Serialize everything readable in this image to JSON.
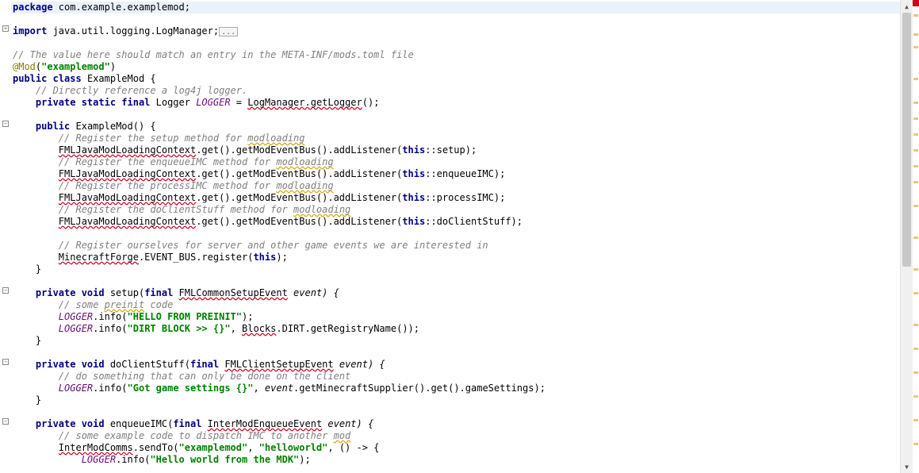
{
  "code": {
    "l1_kw1": "package",
    "l1_pkg": " com.example.examplemod;",
    "l3_kw": "import",
    "l3_txt": " java.util.logging.LogManager;",
    "l5": "// The value here should match an entry in the META-INF/mods.toml file",
    "l6_ann": "@Mod",
    "l6_p": "(",
    "l6_str": "\"examplemod\"",
    "l6_p2": ")",
    "l7_kw1": "public",
    "l7_kw2": "class",
    "l7_name": " ExampleMod {",
    "l8": "    // Directly reference a log4j logger.",
    "l9_kw": "private static final",
    "l9_type": " Logger ",
    "l9_fld": "LOGGER",
    "l9_eq": " = ",
    "l9_err": "LogManager.getLogger",
    "l9_end": "();",
    "l11_kw": "public",
    "l11_txt": " ExampleMod() {",
    "l12": "        // Register the setup method for ",
    "l12_warn": "modloading",
    "l13_a": "        ",
    "l13_err": "FMLJavaModLoadingContext",
    "l13_b": ".get().getModEventBus().addListener(",
    "l13_kw": "this",
    "l13_c": "::setup);",
    "l14": "        // Register the enqueueIMC method for ",
    "l14_warn": "modloading",
    "l15_a": "        ",
    "l15_err": "FMLJavaModLoadingContext",
    "l15_b": ".get().getModEventBus().addListener(",
    "l15_kw": "this",
    "l15_c": "::enqueueIMC);",
    "l16": "        // Register the processIMC method for ",
    "l16_warn": "modloading",
    "l17_a": "        ",
    "l17_err": "FMLJavaModLoadingContext",
    "l17_b": ".get().getModEventBus().addListener(",
    "l17_kw": "this",
    "l17_c": "::processIMC);",
    "l18": "        // Register the doClientStuff method for ",
    "l18_warn": "modloading",
    "l19_a": "        ",
    "l19_err": "FMLJavaModLoadingContext",
    "l19_b": ".get().getModEventBus().addListener(",
    "l19_kw": "this",
    "l19_c": "::doClientStuff);",
    "l21": "        // Register ourselves for server and other game events we are interested in",
    "l22_a": "        ",
    "l22_err": "MinecraftForge",
    "l22_b": ".EVENT_BUS.register(",
    "l22_kw": "this",
    "l22_c": ");",
    "l23": "    }",
    "l25_kw": "private void",
    "l25_name": " setup(",
    "l25_kw2": "final",
    "l25_sp": " ",
    "l25_err": "FMLCommonSetupEvent",
    "l25_p": " event) {",
    "l26": "        // some ",
    "l26_warn": "preinit",
    "l26_b": " code",
    "l27_a": "        ",
    "l27_fld": "LOGGER",
    "l27_b": ".info(",
    "l27_str": "\"HELLO FROM PREINIT\"",
    "l27_c": ");",
    "l28_a": "        ",
    "l28_fld": "LOGGER",
    "l28_b": ".info(",
    "l28_str": "\"DIRT BLOCK >> {}\"",
    "l28_c": ", ",
    "l28_err": "Blocks",
    "l28_d": ".DIRT.getRegistryName());",
    "l29": "    }",
    "l31_kw": "private void",
    "l31_name": " doClientStuff(",
    "l31_kw2": "final",
    "l31_sp": " ",
    "l31_err": "FMLClientSetupEvent",
    "l31_p": " event) {",
    "l32": "        // do something that can only be done on the client",
    "l33_a": "        ",
    "l33_fld": "LOGGER",
    "l33_b": ".info(",
    "l33_str": "\"Got game settings {}\"",
    "l33_c": ", ",
    "l33_p": "event",
    "l33_d": ".getMinecraftSupplier().get().gameSettings);",
    "l34": "    }",
    "l36_kw": "private void",
    "l36_name": " enqueueIMC(",
    "l36_kw2": "final",
    "l36_sp": " ",
    "l36_err": "InterModEnqueueEvent",
    "l36_p": " event) {",
    "l37": "        // some example code to dispatch IMC to another ",
    "l37_warn": "mod",
    "l38_a": "        ",
    "l38_err": "InterModComms",
    "l38_b": ".sendTo(",
    "l38_s1": "\"examplemod\"",
    "l38_c": ", ",
    "l38_s2": "\"helloworld\"",
    "l38_d": ", () -> {",
    "l39_a": "            ",
    "l39_fld": "LOGGER",
    "l39_b": ".info(",
    "l39_str": "\"Hello world from the MDK\"",
    "l39_c": ");"
  },
  "fold_ellipsis": "..."
}
